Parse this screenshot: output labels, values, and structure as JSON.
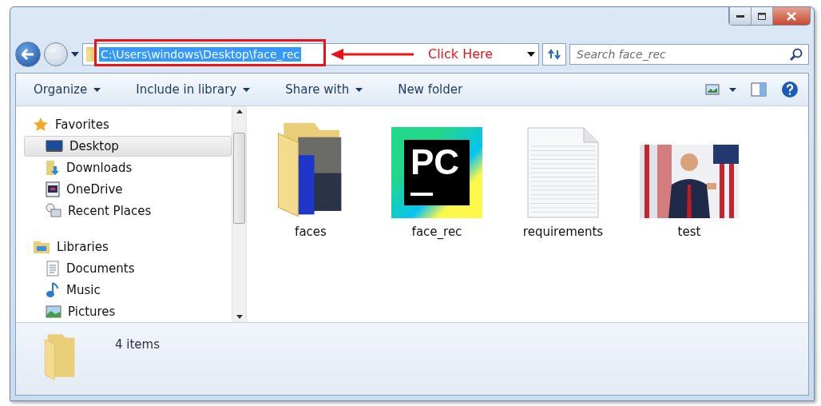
{
  "address": {
    "path": "C:\\Users\\windows\\Desktop\\face_rec",
    "selected": true
  },
  "annotation": {
    "text": "Click Here"
  },
  "search": {
    "placeholder": "Search face_rec"
  },
  "toolbar": [
    {
      "label": "Organize",
      "dropdown": true
    },
    {
      "label": "Include in library",
      "dropdown": true
    },
    {
      "label": "Share with",
      "dropdown": true
    },
    {
      "label": "New folder",
      "dropdown": false
    }
  ],
  "nav": [
    {
      "label": "Favorites",
      "kind": "favorites",
      "children": [
        {
          "label": "Desktop",
          "kind": "desktop",
          "selected": true
        },
        {
          "label": "Downloads",
          "kind": "downloads",
          "selected": false
        },
        {
          "label": "OneDrive",
          "kind": "onedrive",
          "selected": false
        },
        {
          "label": "Recent Places",
          "kind": "recent",
          "selected": false
        }
      ]
    },
    {
      "label": "Libraries",
      "kind": "libraries",
      "children": [
        {
          "label": "Documents",
          "kind": "documents",
          "selected": false
        },
        {
          "label": "Music",
          "kind": "music",
          "selected": false
        },
        {
          "label": "Pictures",
          "kind": "pictures",
          "selected": false
        }
      ]
    }
  ],
  "files": [
    {
      "name": "faces",
      "kind": "folder"
    },
    {
      "name": "face_rec",
      "kind": "pycharm",
      "logo_text": "PC"
    },
    {
      "name": "requirements",
      "kind": "text"
    },
    {
      "name": "test",
      "kind": "picture"
    }
  ],
  "status": {
    "count": "4 items"
  }
}
